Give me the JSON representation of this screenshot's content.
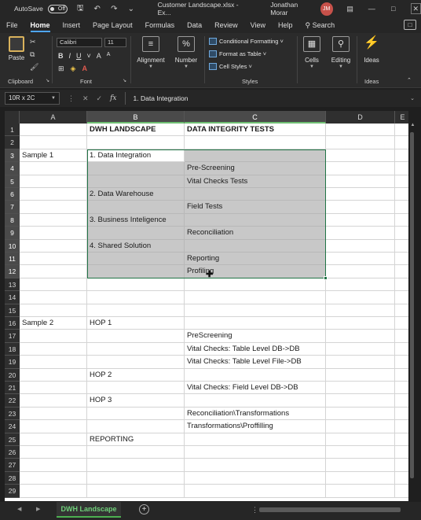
{
  "titlebar": {
    "autosave_label": "AutoSave",
    "autosave_state": "Off",
    "document_title": "Customer Landscape.xlsx  -  Ex...",
    "user_name": "Jonathan Morar",
    "user_initials": "JM"
  },
  "menu": {
    "tabs": [
      "File",
      "Home",
      "Insert",
      "Page Layout",
      "Formulas",
      "Data",
      "Review",
      "View",
      "Help",
      "Search"
    ],
    "active": "Home"
  },
  "ribbon": {
    "clipboard": {
      "paste_label": "Paste",
      "group_label": "Clipboard"
    },
    "font": {
      "font_name": "Calibri",
      "font_size": "11",
      "group_label": "Font",
      "bold": "B",
      "italic": "I",
      "underline": "U",
      "grow": "A",
      "shrink": "A"
    },
    "alignment": {
      "label": "Alignment"
    },
    "number": {
      "label": "Number",
      "icon_text": "%"
    },
    "styles": {
      "conditional_formatting": "Conditional Formatting",
      "format_as_table": "Format as Table",
      "cell_styles": "Cell Styles",
      "group_label": "Styles"
    },
    "cells": {
      "label": "Cells"
    },
    "editing": {
      "label": "Editing"
    },
    "ideas": {
      "label": "Ideas",
      "group_label": "Ideas"
    }
  },
  "formula_bar": {
    "name_box": "10R x 2C",
    "formula": "1. Data Integration"
  },
  "sheet": {
    "columns": [
      "A",
      "B",
      "C",
      "D",
      "E"
    ],
    "rows": [
      {
        "n": "1",
        "a": "",
        "b": "DWH LANDSCAPE",
        "c": "DATA INTEGRITY TESTS"
      },
      {
        "n": "2",
        "a": "",
        "b": "",
        "c": ""
      },
      {
        "n": "3",
        "a": "Sample 1",
        "b": "1. Data Integration",
        "c": ""
      },
      {
        "n": "4",
        "a": "",
        "b": "",
        "c": "Pre-Screening"
      },
      {
        "n": "5",
        "a": "",
        "b": "",
        "c": "Vital Checks Tests"
      },
      {
        "n": "6",
        "a": "",
        "b": "2. Data Warehouse",
        "c": ""
      },
      {
        "n": "7",
        "a": "",
        "b": "",
        "c": "Field Tests"
      },
      {
        "n": "8",
        "a": "",
        "b": "3. Business Inteligence",
        "c": ""
      },
      {
        "n": "9",
        "a": "",
        "b": "",
        "c": "Reconciliation"
      },
      {
        "n": "10",
        "a": "",
        "b": "4. Shared Solution",
        "c": ""
      },
      {
        "n": "11",
        "a": "",
        "b": "",
        "c": "Reporting"
      },
      {
        "n": "12",
        "a": "",
        "b": "",
        "c": "Profiling"
      },
      {
        "n": "13",
        "a": "",
        "b": "",
        "c": ""
      },
      {
        "n": "14",
        "a": "",
        "b": "",
        "c": ""
      },
      {
        "n": "15",
        "a": "",
        "b": "",
        "c": ""
      },
      {
        "n": "16",
        "a": "Sample 2",
        "b": "HOP 1",
        "c": ""
      },
      {
        "n": "17",
        "a": "",
        "b": "",
        "c": "PreScreening"
      },
      {
        "n": "18",
        "a": "",
        "b": "",
        "c": "Vital Checks: Table Level DB->DB"
      },
      {
        "n": "19",
        "a": "",
        "b": "",
        "c": "Vital Checks: Table Level File->DB"
      },
      {
        "n": "20",
        "a": "",
        "b": "HOP 2",
        "c": ""
      },
      {
        "n": "21",
        "a": "",
        "b": "",
        "c": "Vital Checks: Field Level DB->DB"
      },
      {
        "n": "22",
        "a": "",
        "b": "HOP 3",
        "c": ""
      },
      {
        "n": "23",
        "a": "",
        "b": "",
        "c": "Reconciliation\\Transformations"
      },
      {
        "n": "24",
        "a": "",
        "b": "",
        "c": "Transformations\\Proffilling"
      },
      {
        "n": "25",
        "a": "",
        "b": "REPORTING",
        "c": ""
      },
      {
        "n": "26",
        "a": "",
        "b": "",
        "c": ""
      },
      {
        "n": "27",
        "a": "",
        "b": "",
        "c": ""
      },
      {
        "n": "28",
        "a": "",
        "b": "",
        "c": ""
      },
      {
        "n": "29",
        "a": "",
        "b": "",
        "c": ""
      }
    ]
  },
  "sheet_tabs": {
    "active": "DWH Landscape"
  }
}
